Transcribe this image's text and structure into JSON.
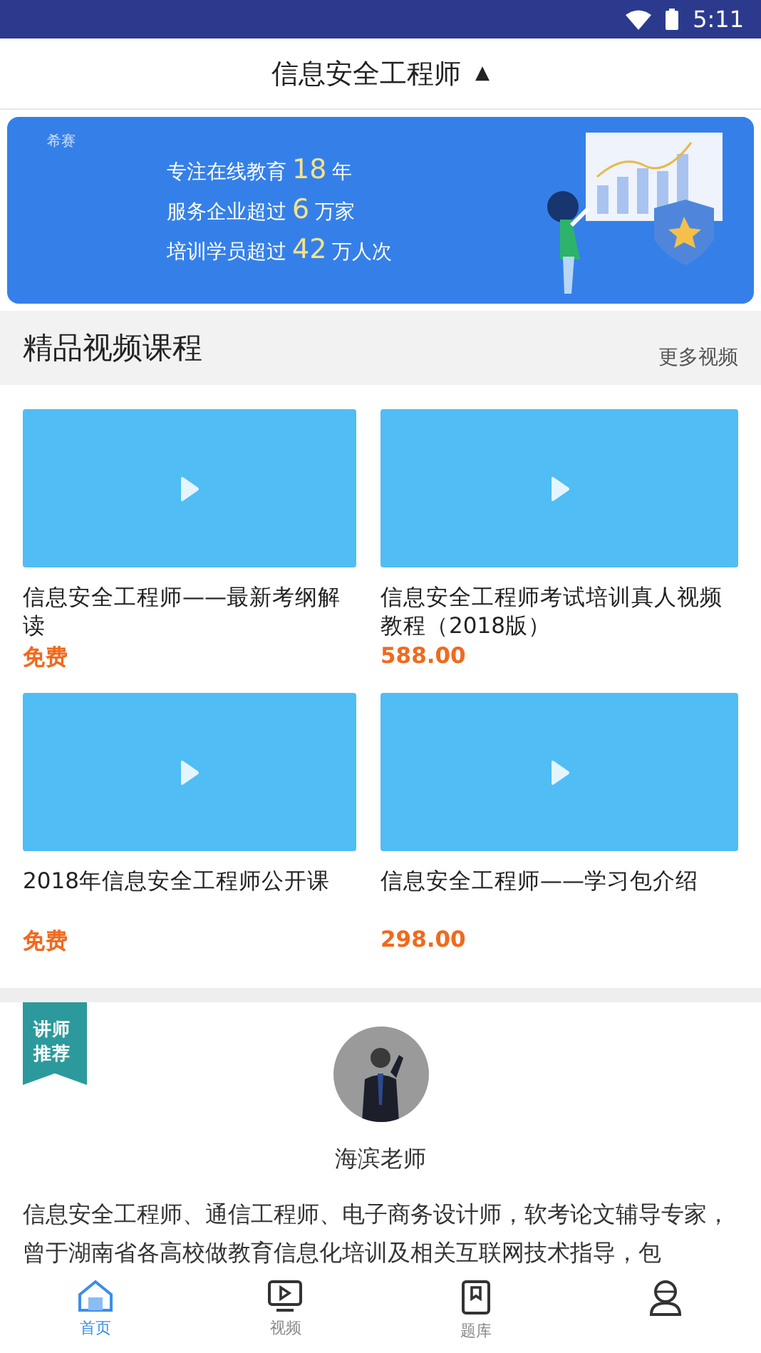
{
  "status_bar": {
    "time": "5:11"
  },
  "header": {
    "title": "信息安全工程师",
    "caret": "▲"
  },
  "banner": {
    "logo": "希赛",
    "lines": [
      {
        "before": "专注在线教育",
        "number": "18",
        "after": "年"
      },
      {
        "before": "服务企业超过",
        "number": "6",
        "after": "万家"
      },
      {
        "before": "培训学员超过",
        "number": "42",
        "after": "万人次"
      }
    ]
  },
  "section": {
    "title": "精品视频课程",
    "more": "更多视频"
  },
  "courses": [
    {
      "title": "信息安全工程师——最新考纲解读",
      "price": "免费"
    },
    {
      "title": "信息安全工程师考试培训真人视频教程（2018版）",
      "price": "588.00"
    },
    {
      "title": "2018年信息安全工程师公开课",
      "price": "免费"
    },
    {
      "title": "信息安全工程师——学习包介绍",
      "price": "298.00"
    }
  ],
  "teacher": {
    "ribbon": "讲师推荐",
    "name": "海滨老师",
    "bio": "信息安全工程师、通信工程师、电子商务设计师，软考论文辅导专家，曾于湖南省各高校做教育信息化培训及相关互联网技术指导，包"
  },
  "nav": [
    {
      "kind": "home",
      "label": "首页",
      "selected": true
    },
    {
      "kind": "video",
      "label": "视频",
      "selected": false
    },
    {
      "kind": "bank",
      "label": "题库",
      "selected": false
    },
    {
      "kind": "user",
      "selected": false
    }
  ]
}
